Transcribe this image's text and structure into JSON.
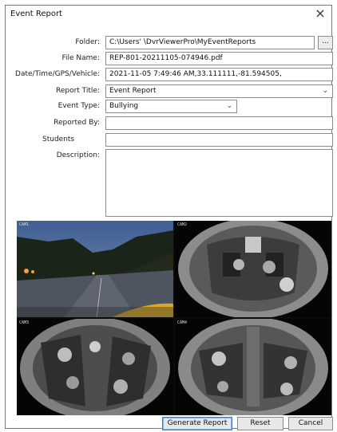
{
  "window": {
    "title": "Event Report",
    "close_glyph": "×"
  },
  "form": {
    "folder": {
      "label": "Folder:",
      "value": "C:\\Users'      \\DvrViewerPro\\MyEventReports",
      "browse_label": "..."
    },
    "file_name": {
      "label": "File Name:",
      "value": "REP-801-20211105-074946.pdf"
    },
    "date_gps": {
      "label": "Date/Time/GPS/Vehicle:",
      "value": "2021-11-05 7:49:46 AM,33.111111,-81.594505,"
    },
    "report_title": {
      "label": "Report Title:",
      "value": "Event Report"
    },
    "event_type": {
      "label": "Event Type:",
      "value": "Bullying"
    },
    "reported_by": {
      "label": "Reported By:",
      "value": ""
    },
    "students": {
      "label": "Students",
      "value": ""
    },
    "description": {
      "label": "Description:",
      "value": ""
    }
  },
  "cameras": [
    {
      "name": "camera-1",
      "label": "Exterior front view"
    },
    {
      "name": "camera-2",
      "label": "Interior fisheye view"
    },
    {
      "name": "camera-3",
      "label": "Interior fisheye view"
    },
    {
      "name": "camera-4",
      "label": "Interior fisheye view"
    }
  ],
  "buttons": {
    "generate": "Generate Report",
    "reset": "Reset",
    "cancel": "Cancel"
  },
  "icons": {
    "close": "close-icon",
    "dropdown": "chevron-down-icon"
  }
}
